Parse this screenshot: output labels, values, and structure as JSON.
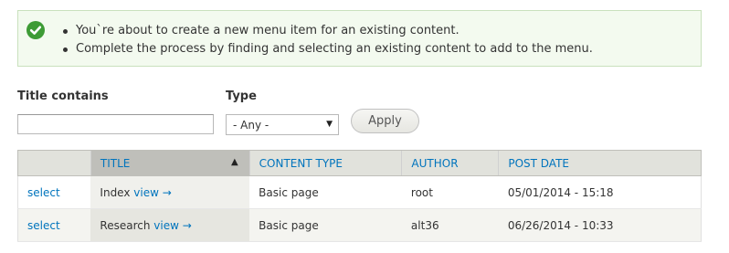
{
  "message": {
    "icon": "check-circle-icon",
    "items": [
      "You`re about to create a new menu item for an existing content.",
      "Complete the process by finding and selecting an existing content to add to the menu."
    ]
  },
  "filters": {
    "title_label": "Title contains",
    "title_value": "",
    "type_label": "Type",
    "type_selected": "- Any -",
    "apply_label": "Apply"
  },
  "table": {
    "columns": [
      "",
      "TITLE",
      "CONTENT TYPE",
      "AUTHOR",
      "POST DATE"
    ],
    "sorted_column": "TITLE",
    "sort_direction": "asc",
    "rows": [
      {
        "select": "select",
        "title": "Index",
        "view": "view →",
        "type": "Basic page",
        "author": "root",
        "date": "05/01/2014 - 15:18"
      },
      {
        "select": "select",
        "title": "Research",
        "view": "view →",
        "type": "Basic page",
        "author": "alt36",
        "date": "06/26/2014 - 10:33"
      }
    ]
  },
  "colors": {
    "link": "#0074bd",
    "success_bg": "#f3faef",
    "success_icon": "#3d9b35"
  }
}
